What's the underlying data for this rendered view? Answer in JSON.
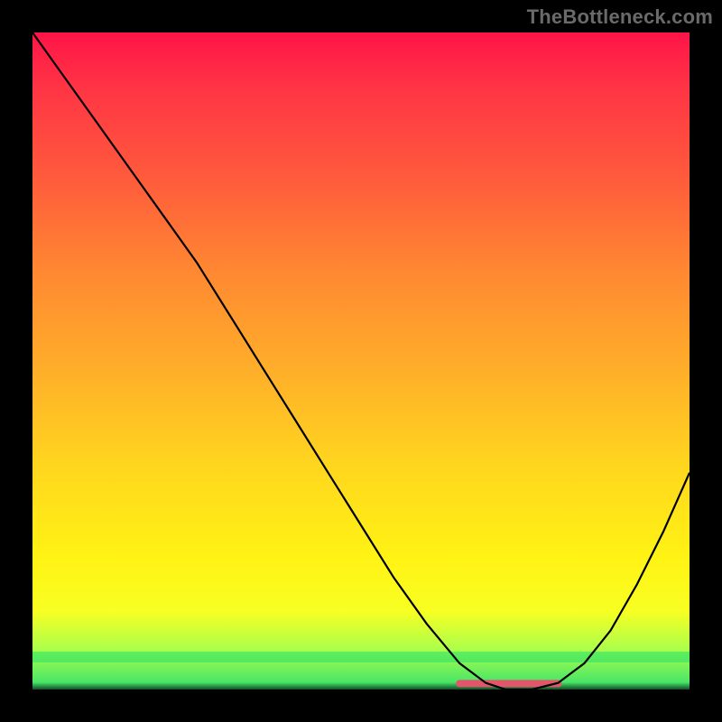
{
  "watermark": "TheBottleneck.com",
  "chart_data": {
    "type": "line",
    "title": "",
    "xlabel": "",
    "ylabel": "",
    "xlim": [
      0,
      100
    ],
    "ylim": [
      0,
      100
    ],
    "series": [
      {
        "name": "bottleneck-curve",
        "x": [
          0,
          5,
          10,
          15,
          20,
          25,
          30,
          35,
          40,
          45,
          50,
          55,
          60,
          65,
          69,
          72,
          76,
          80,
          84,
          88,
          92,
          96,
          100
        ],
        "values": [
          100,
          93,
          86,
          79,
          72,
          65,
          57,
          49,
          41,
          33,
          25,
          17,
          10,
          4,
          1,
          0,
          0,
          1,
          4,
          9,
          16,
          24,
          33
        ]
      }
    ],
    "trough": {
      "x_start": 65,
      "x_end": 80,
      "y": 0.5
    },
    "gradient_stops": [
      {
        "pos": 0,
        "color": "#ff1448"
      },
      {
        "pos": 50,
        "color": "#ffb029"
      },
      {
        "pos": 80,
        "color": "#fff314"
      },
      {
        "pos": 100,
        "color": "#34e06c"
      }
    ]
  }
}
